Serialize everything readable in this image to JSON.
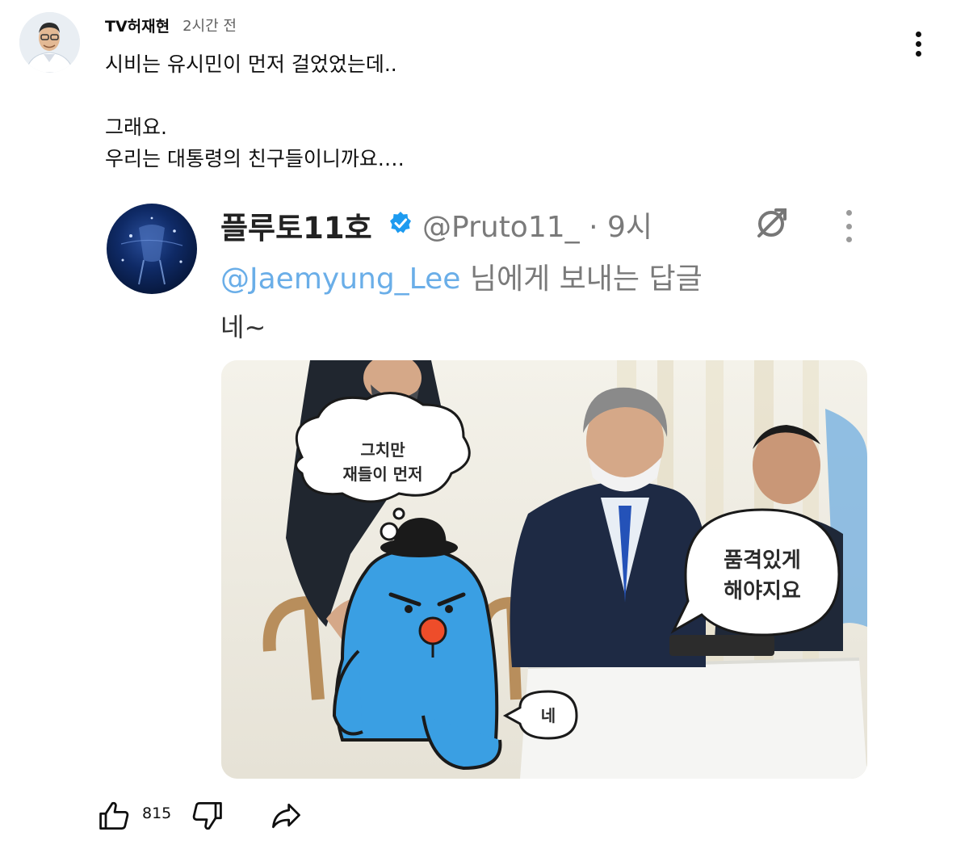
{
  "comment": {
    "author": "TV허재현",
    "time": "2시간 전",
    "lines": [
      "시비는 유시민이 먼저 걸었었는데..",
      "",
      "그래요.",
      "우리는 대통령의 친구들이니까요.…"
    ]
  },
  "embedded_tweet": {
    "name": "플루토11호",
    "handle_time": "@Pruto11_ · 9시",
    "reply_mention": "@Jaemyung_Lee",
    "reply_suffix": " 님에게 보내는 답글",
    "body": "네~",
    "image": {
      "bubble_left": [
        "그치만",
        "재들이 먼저"
      ],
      "bubble_right": [
        "품격있게",
        "해야지요"
      ],
      "bubble_small": "네"
    }
  },
  "actions": {
    "like_count": "815"
  },
  "icons": {
    "menu": "vertical-ellipsis-icon",
    "like": "thumbs-up-icon",
    "dislike": "thumbs-down-icon",
    "share": "share-arrow-icon",
    "verified": "verified-badge-icon",
    "expand": "expand-icon"
  },
  "colors": {
    "verified": "#1d9bf0",
    "mention": "#6aaee8",
    "character": "#3a9fe3"
  }
}
